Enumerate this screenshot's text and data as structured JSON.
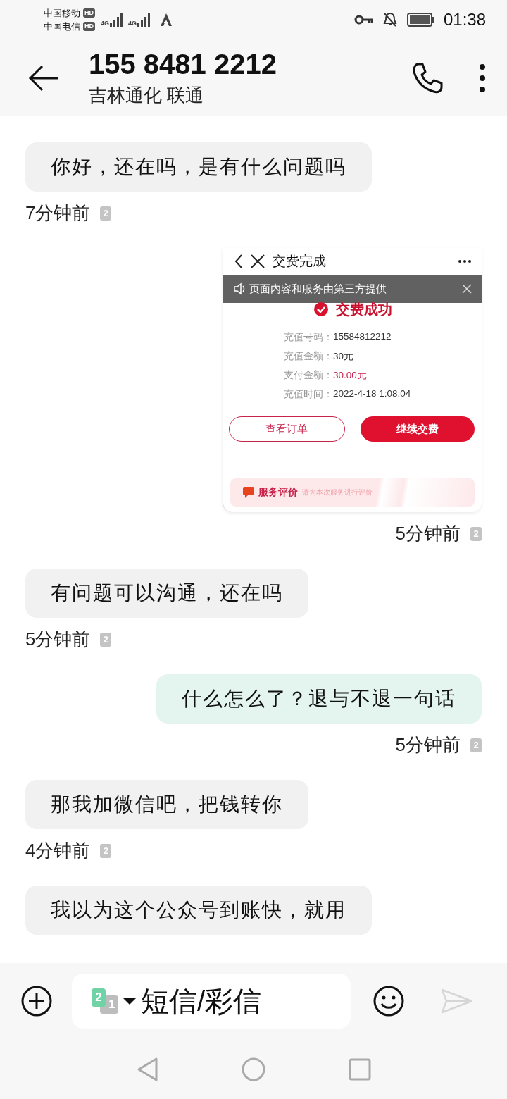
{
  "status_bar": {
    "carriers": [
      {
        "name": "中国移动",
        "badge": "HD"
      },
      {
        "name": "中国电信",
        "badge": "HD"
      }
    ],
    "signals": [
      {
        "label": "4G"
      },
      {
        "label": "4G"
      }
    ],
    "time": "01:38"
  },
  "header": {
    "title": "155 8481 2212",
    "subtitle": "吉林通化 联通"
  },
  "messages": [
    {
      "kind": "text",
      "outgoing": false,
      "text": "你好，还在吗，是有什么问题吗",
      "time": "7分钟前",
      "sim": "2"
    },
    {
      "kind": "image",
      "outgoing": true,
      "time": "5分钟前",
      "sim": "2",
      "shot": {
        "title": "交费完成",
        "notice": "页面内容和服务由第三方提供",
        "status": "交费成功",
        "rows": [
          {
            "label": "充值号码：",
            "value": "15584812212",
            "highlight": false
          },
          {
            "label": "充值金额：",
            "value": "30元",
            "highlight": false
          },
          {
            "label": "支付金额：",
            "value": "30.00元",
            "highlight": true
          },
          {
            "label": "充值时间：",
            "value": "2022-4-18 1:08:04",
            "highlight": false
          }
        ],
        "buttons": [
          {
            "label": "查看订单",
            "kind": "outline"
          },
          {
            "label": "继续交费",
            "kind": "filled"
          }
        ],
        "rating": {
          "title": "服务评价",
          "hint": "请为本次服务进行评价"
        }
      }
    },
    {
      "kind": "text",
      "outgoing": false,
      "text": "有问题可以沟通，还在吗",
      "time": "5分钟前",
      "sim": "2"
    },
    {
      "kind": "text",
      "outgoing": true,
      "text": "什么怎么了？退与不退一句话",
      "time": "5分钟前",
      "sim": "2"
    },
    {
      "kind": "text",
      "outgoing": false,
      "text": "那我加微信吧，把钱转你",
      "time": "4分钟前",
      "sim": "2"
    },
    {
      "kind": "text",
      "outgoing": false,
      "text": "我以为这个公众号到账快，就用"
    }
  ],
  "compose": {
    "sim": {
      "primary": "2",
      "secondary": "1"
    },
    "placeholder": "短信/彩信"
  }
}
